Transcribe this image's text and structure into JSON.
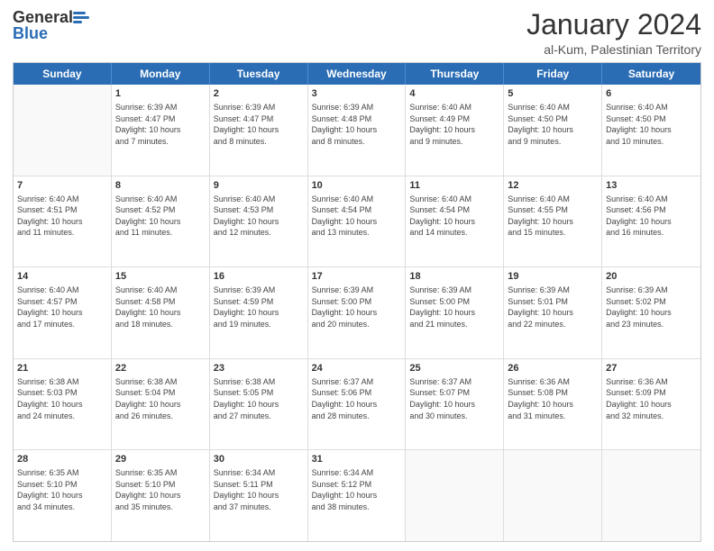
{
  "header": {
    "logo_general": "General",
    "logo_blue": "Blue",
    "title": "January 2024",
    "subtitle": "al-Kum, Palestinian Territory"
  },
  "days": [
    "Sunday",
    "Monday",
    "Tuesday",
    "Wednesday",
    "Thursday",
    "Friday",
    "Saturday"
  ],
  "weeks": [
    [
      {
        "day": "",
        "info": ""
      },
      {
        "day": "1",
        "info": "Sunrise: 6:39 AM\nSunset: 4:47 PM\nDaylight: 10 hours\nand 7 minutes."
      },
      {
        "day": "2",
        "info": "Sunrise: 6:39 AM\nSunset: 4:47 PM\nDaylight: 10 hours\nand 8 minutes."
      },
      {
        "day": "3",
        "info": "Sunrise: 6:39 AM\nSunset: 4:48 PM\nDaylight: 10 hours\nand 8 minutes."
      },
      {
        "day": "4",
        "info": "Sunrise: 6:40 AM\nSunset: 4:49 PM\nDaylight: 10 hours\nand 9 minutes."
      },
      {
        "day": "5",
        "info": "Sunrise: 6:40 AM\nSunset: 4:50 PM\nDaylight: 10 hours\nand 9 minutes."
      },
      {
        "day": "6",
        "info": "Sunrise: 6:40 AM\nSunset: 4:50 PM\nDaylight: 10 hours\nand 10 minutes."
      }
    ],
    [
      {
        "day": "7",
        "info": "Sunrise: 6:40 AM\nSunset: 4:51 PM\nDaylight: 10 hours\nand 11 minutes."
      },
      {
        "day": "8",
        "info": "Sunrise: 6:40 AM\nSunset: 4:52 PM\nDaylight: 10 hours\nand 11 minutes."
      },
      {
        "day": "9",
        "info": "Sunrise: 6:40 AM\nSunset: 4:53 PM\nDaylight: 10 hours\nand 12 minutes."
      },
      {
        "day": "10",
        "info": "Sunrise: 6:40 AM\nSunset: 4:54 PM\nDaylight: 10 hours\nand 13 minutes."
      },
      {
        "day": "11",
        "info": "Sunrise: 6:40 AM\nSunset: 4:54 PM\nDaylight: 10 hours\nand 14 minutes."
      },
      {
        "day": "12",
        "info": "Sunrise: 6:40 AM\nSunset: 4:55 PM\nDaylight: 10 hours\nand 15 minutes."
      },
      {
        "day": "13",
        "info": "Sunrise: 6:40 AM\nSunset: 4:56 PM\nDaylight: 10 hours\nand 16 minutes."
      }
    ],
    [
      {
        "day": "14",
        "info": "Sunrise: 6:40 AM\nSunset: 4:57 PM\nDaylight: 10 hours\nand 17 minutes."
      },
      {
        "day": "15",
        "info": "Sunrise: 6:40 AM\nSunset: 4:58 PM\nDaylight: 10 hours\nand 18 minutes."
      },
      {
        "day": "16",
        "info": "Sunrise: 6:39 AM\nSunset: 4:59 PM\nDaylight: 10 hours\nand 19 minutes."
      },
      {
        "day": "17",
        "info": "Sunrise: 6:39 AM\nSunset: 5:00 PM\nDaylight: 10 hours\nand 20 minutes."
      },
      {
        "day": "18",
        "info": "Sunrise: 6:39 AM\nSunset: 5:00 PM\nDaylight: 10 hours\nand 21 minutes."
      },
      {
        "day": "19",
        "info": "Sunrise: 6:39 AM\nSunset: 5:01 PM\nDaylight: 10 hours\nand 22 minutes."
      },
      {
        "day": "20",
        "info": "Sunrise: 6:39 AM\nSunset: 5:02 PM\nDaylight: 10 hours\nand 23 minutes."
      }
    ],
    [
      {
        "day": "21",
        "info": "Sunrise: 6:38 AM\nSunset: 5:03 PM\nDaylight: 10 hours\nand 24 minutes."
      },
      {
        "day": "22",
        "info": "Sunrise: 6:38 AM\nSunset: 5:04 PM\nDaylight: 10 hours\nand 26 minutes."
      },
      {
        "day": "23",
        "info": "Sunrise: 6:38 AM\nSunset: 5:05 PM\nDaylight: 10 hours\nand 27 minutes."
      },
      {
        "day": "24",
        "info": "Sunrise: 6:37 AM\nSunset: 5:06 PM\nDaylight: 10 hours\nand 28 minutes."
      },
      {
        "day": "25",
        "info": "Sunrise: 6:37 AM\nSunset: 5:07 PM\nDaylight: 10 hours\nand 30 minutes."
      },
      {
        "day": "26",
        "info": "Sunrise: 6:36 AM\nSunset: 5:08 PM\nDaylight: 10 hours\nand 31 minutes."
      },
      {
        "day": "27",
        "info": "Sunrise: 6:36 AM\nSunset: 5:09 PM\nDaylight: 10 hours\nand 32 minutes."
      }
    ],
    [
      {
        "day": "28",
        "info": "Sunrise: 6:35 AM\nSunset: 5:10 PM\nDaylight: 10 hours\nand 34 minutes."
      },
      {
        "day": "29",
        "info": "Sunrise: 6:35 AM\nSunset: 5:10 PM\nDaylight: 10 hours\nand 35 minutes."
      },
      {
        "day": "30",
        "info": "Sunrise: 6:34 AM\nSunset: 5:11 PM\nDaylight: 10 hours\nand 37 minutes."
      },
      {
        "day": "31",
        "info": "Sunrise: 6:34 AM\nSunset: 5:12 PM\nDaylight: 10 hours\nand 38 minutes."
      },
      {
        "day": "",
        "info": ""
      },
      {
        "day": "",
        "info": ""
      },
      {
        "day": "",
        "info": ""
      }
    ]
  ]
}
